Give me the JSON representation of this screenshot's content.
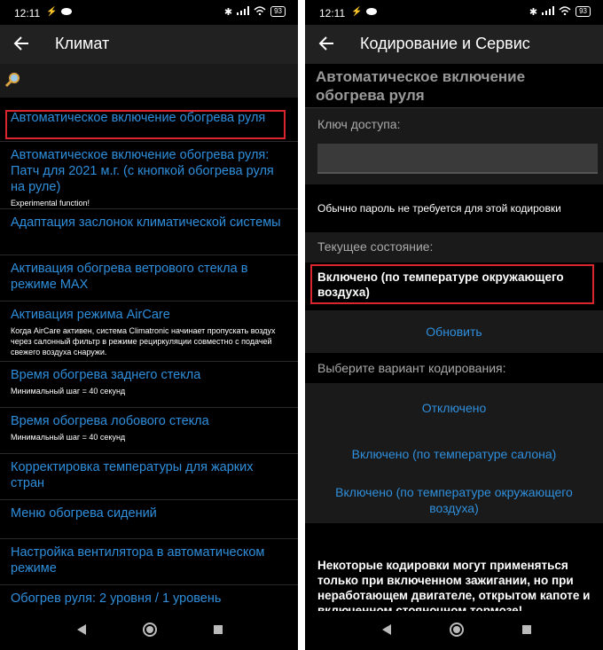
{
  "status": {
    "time": "12:11",
    "battery": "93"
  },
  "left": {
    "title": "Климат",
    "items": [
      {
        "label": "Автоматическое включение обогрева руля",
        "sub": ""
      },
      {
        "label": "Автоматическое включение обогрева руля: Патч для 2021 м.г. (с кнопкой обогрева руля на руле)",
        "sub": "Experimental function!"
      },
      {
        "label": "Адаптация заслонок климатической системы",
        "sub": ""
      },
      {
        "label": "Активация обогрева ветрового стекла в режиме MAX",
        "sub": ""
      },
      {
        "label": "Активация режима AirCare",
        "sub": "Когда AirCare активен, система Climatronic начинает пропускать воздух через салонный фильтр в режиме рециркуляции совместно с подачей свежего воздуха снаружи."
      },
      {
        "label": "Время обогрева заднего стекла",
        "sub": "Минимальный шаг = 40 секунд"
      },
      {
        "label": "Время обогрева лобового стекла",
        "sub": "Минимальный шаг = 40 секунд"
      },
      {
        "label": "Корректировка температуры для жарких стран",
        "sub": ""
      },
      {
        "label": "Меню обогрева сидений",
        "sub": ""
      },
      {
        "label": "Настройка вентилятора в автоматическом режиме",
        "sub": ""
      },
      {
        "label": "Обогрев руля: 2 уровня / 1 уровень",
        "sub": ""
      }
    ]
  },
  "right": {
    "title": "Кодирование и Сервис",
    "heading": "Автоматическое включение обогрева руля",
    "access_key_label": "Ключ доступа:",
    "password_note": "Обычно пароль не требуется для этой кодировки",
    "current_state_label": "Текущее состояние:",
    "current_state_value": "Включено (по температуре окружающего воздуха)",
    "refresh_button": "Обновить",
    "choose_label": "Выберите вариант кодирования:",
    "options": [
      "Отключено",
      "Включено (по температуре салона)",
      "Включено (по температуре окружающего воздуха)"
    ],
    "warning": "Некоторые кодировки могут применяться только при включенном зажигании, но при неработающем двигателе, открытом капоте и включенном стояночном тормозе!"
  },
  "colors": {
    "link": "#2f8fdc",
    "highlight": "#d9262e",
    "appbar": "#212121"
  }
}
